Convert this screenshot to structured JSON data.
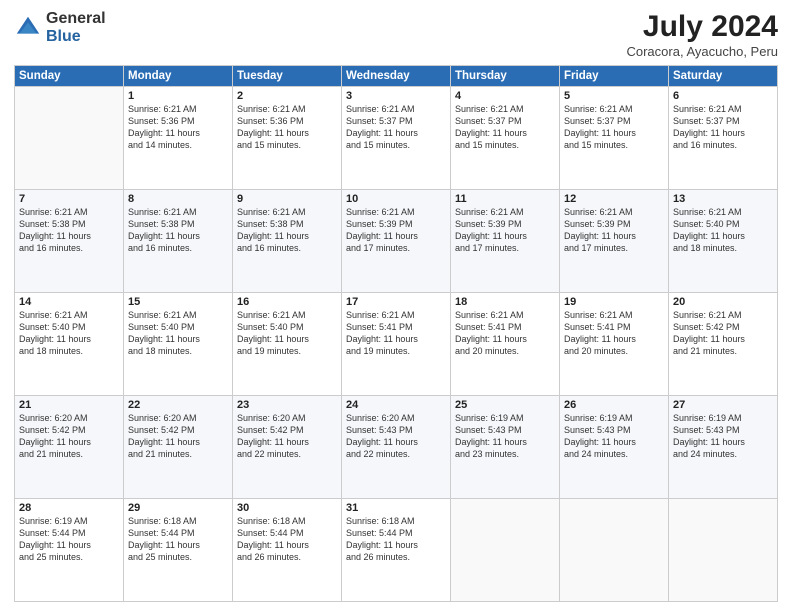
{
  "header": {
    "logo": {
      "line1": "General",
      "line2": "Blue"
    },
    "title": "July 2024",
    "location": "Coracora, Ayacucho, Peru"
  },
  "days_of_week": [
    "Sunday",
    "Monday",
    "Tuesday",
    "Wednesday",
    "Thursday",
    "Friday",
    "Saturday"
  ],
  "weeks": [
    [
      {
        "day": "",
        "text": ""
      },
      {
        "day": "1",
        "text": "Sunrise: 6:21 AM\nSunset: 5:36 PM\nDaylight: 11 hours\nand 14 minutes."
      },
      {
        "day": "2",
        "text": "Sunrise: 6:21 AM\nSunset: 5:36 PM\nDaylight: 11 hours\nand 15 minutes."
      },
      {
        "day": "3",
        "text": "Sunrise: 6:21 AM\nSunset: 5:37 PM\nDaylight: 11 hours\nand 15 minutes."
      },
      {
        "day": "4",
        "text": "Sunrise: 6:21 AM\nSunset: 5:37 PM\nDaylight: 11 hours\nand 15 minutes."
      },
      {
        "day": "5",
        "text": "Sunrise: 6:21 AM\nSunset: 5:37 PM\nDaylight: 11 hours\nand 15 minutes."
      },
      {
        "day": "6",
        "text": "Sunrise: 6:21 AM\nSunset: 5:37 PM\nDaylight: 11 hours\nand 16 minutes."
      }
    ],
    [
      {
        "day": "7",
        "text": "Sunrise: 6:21 AM\nSunset: 5:38 PM\nDaylight: 11 hours\nand 16 minutes."
      },
      {
        "day": "8",
        "text": "Sunrise: 6:21 AM\nSunset: 5:38 PM\nDaylight: 11 hours\nand 16 minutes."
      },
      {
        "day": "9",
        "text": "Sunrise: 6:21 AM\nSunset: 5:38 PM\nDaylight: 11 hours\nand 16 minutes."
      },
      {
        "day": "10",
        "text": "Sunrise: 6:21 AM\nSunset: 5:39 PM\nDaylight: 11 hours\nand 17 minutes."
      },
      {
        "day": "11",
        "text": "Sunrise: 6:21 AM\nSunset: 5:39 PM\nDaylight: 11 hours\nand 17 minutes."
      },
      {
        "day": "12",
        "text": "Sunrise: 6:21 AM\nSunset: 5:39 PM\nDaylight: 11 hours\nand 17 minutes."
      },
      {
        "day": "13",
        "text": "Sunrise: 6:21 AM\nSunset: 5:40 PM\nDaylight: 11 hours\nand 18 minutes."
      }
    ],
    [
      {
        "day": "14",
        "text": "Sunrise: 6:21 AM\nSunset: 5:40 PM\nDaylight: 11 hours\nand 18 minutes."
      },
      {
        "day": "15",
        "text": "Sunrise: 6:21 AM\nSunset: 5:40 PM\nDaylight: 11 hours\nand 18 minutes."
      },
      {
        "day": "16",
        "text": "Sunrise: 6:21 AM\nSunset: 5:40 PM\nDaylight: 11 hours\nand 19 minutes."
      },
      {
        "day": "17",
        "text": "Sunrise: 6:21 AM\nSunset: 5:41 PM\nDaylight: 11 hours\nand 19 minutes."
      },
      {
        "day": "18",
        "text": "Sunrise: 6:21 AM\nSunset: 5:41 PM\nDaylight: 11 hours\nand 20 minutes."
      },
      {
        "day": "19",
        "text": "Sunrise: 6:21 AM\nSunset: 5:41 PM\nDaylight: 11 hours\nand 20 minutes."
      },
      {
        "day": "20",
        "text": "Sunrise: 6:21 AM\nSunset: 5:42 PM\nDaylight: 11 hours\nand 21 minutes."
      }
    ],
    [
      {
        "day": "21",
        "text": "Sunrise: 6:20 AM\nSunset: 5:42 PM\nDaylight: 11 hours\nand 21 minutes."
      },
      {
        "day": "22",
        "text": "Sunrise: 6:20 AM\nSunset: 5:42 PM\nDaylight: 11 hours\nand 21 minutes."
      },
      {
        "day": "23",
        "text": "Sunrise: 6:20 AM\nSunset: 5:42 PM\nDaylight: 11 hours\nand 22 minutes."
      },
      {
        "day": "24",
        "text": "Sunrise: 6:20 AM\nSunset: 5:43 PM\nDaylight: 11 hours\nand 22 minutes."
      },
      {
        "day": "25",
        "text": "Sunrise: 6:19 AM\nSunset: 5:43 PM\nDaylight: 11 hours\nand 23 minutes."
      },
      {
        "day": "26",
        "text": "Sunrise: 6:19 AM\nSunset: 5:43 PM\nDaylight: 11 hours\nand 24 minutes."
      },
      {
        "day": "27",
        "text": "Sunrise: 6:19 AM\nSunset: 5:43 PM\nDaylight: 11 hours\nand 24 minutes."
      }
    ],
    [
      {
        "day": "28",
        "text": "Sunrise: 6:19 AM\nSunset: 5:44 PM\nDaylight: 11 hours\nand 25 minutes."
      },
      {
        "day": "29",
        "text": "Sunrise: 6:18 AM\nSunset: 5:44 PM\nDaylight: 11 hours\nand 25 minutes."
      },
      {
        "day": "30",
        "text": "Sunrise: 6:18 AM\nSunset: 5:44 PM\nDaylight: 11 hours\nand 26 minutes."
      },
      {
        "day": "31",
        "text": "Sunrise: 6:18 AM\nSunset: 5:44 PM\nDaylight: 11 hours\nand 26 minutes."
      },
      {
        "day": "",
        "text": ""
      },
      {
        "day": "",
        "text": ""
      },
      {
        "day": "",
        "text": ""
      }
    ]
  ]
}
